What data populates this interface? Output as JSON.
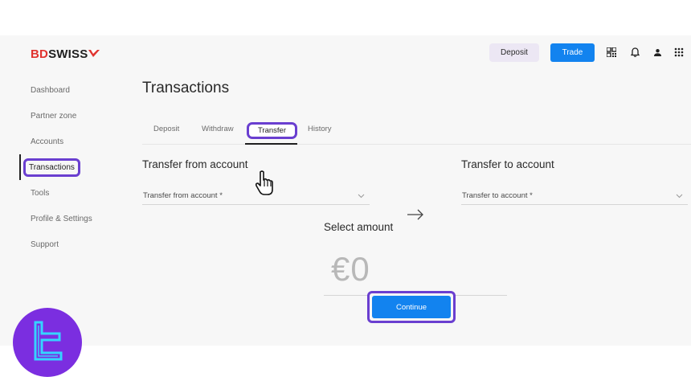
{
  "brand": {
    "logo_bd": "BD",
    "logo_swiss": "SWISS"
  },
  "header": {
    "deposit_label": "Deposit",
    "trade_label": "Trade",
    "icons": [
      "qr-code-icon",
      "bell-icon",
      "user-icon",
      "apps-grid-icon"
    ]
  },
  "sidebar": {
    "items": [
      {
        "label": "Dashboard"
      },
      {
        "label": "Partner zone"
      },
      {
        "label": "Accounts"
      },
      {
        "label": "Transactions",
        "active": true
      },
      {
        "label": "Tools"
      },
      {
        "label": "Profile & Settings"
      },
      {
        "label": "Support"
      }
    ]
  },
  "page": {
    "title": "Transactions"
  },
  "tabs": [
    {
      "label": "Deposit"
    },
    {
      "label": "Withdraw"
    },
    {
      "label": "Transfer",
      "active": true
    },
    {
      "label": "History"
    }
  ],
  "transfer": {
    "from_title": "Transfer from account",
    "from_placeholder": "Transfer from account *",
    "to_title": "Transfer to account",
    "to_placeholder": "Transfer to account *",
    "amount_label": "Select amount",
    "amount_value": "€0",
    "continue_label": "Continue"
  },
  "colors": {
    "accent": "#1283ef",
    "highlight": "#6a3fd0",
    "brand_red": "#e0332f",
    "badge": "#7b2ee0"
  }
}
